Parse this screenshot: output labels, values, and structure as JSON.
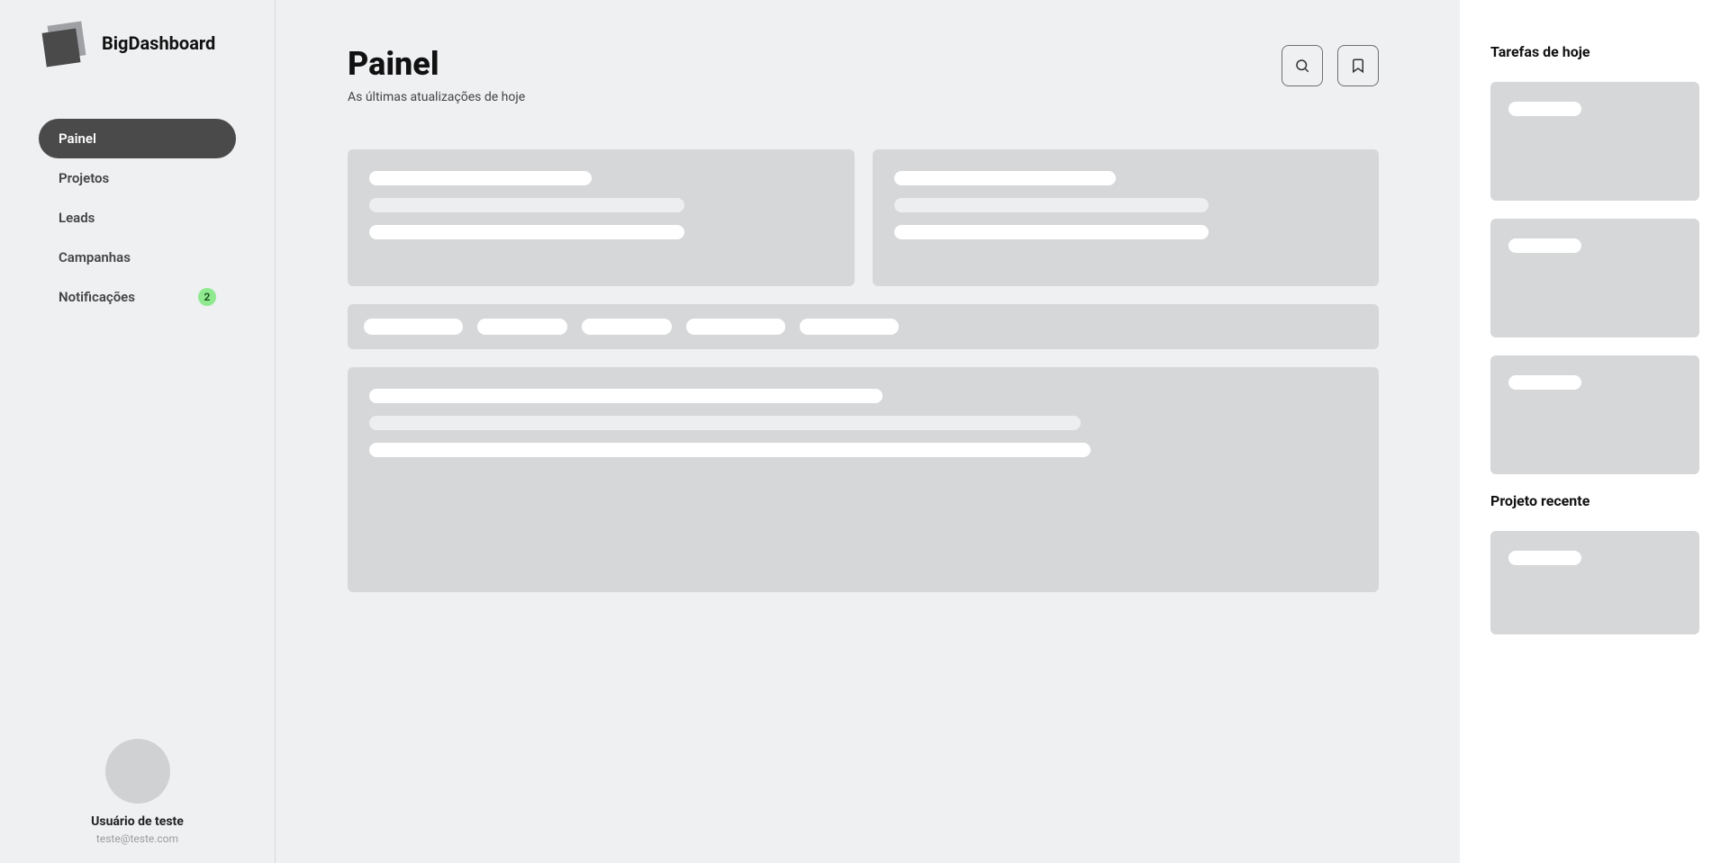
{
  "brand": {
    "title": "BigDashboard"
  },
  "nav": {
    "items": [
      {
        "label": "Painel",
        "active": true
      },
      {
        "label": "Projetos",
        "active": false
      },
      {
        "label": "Leads",
        "active": false
      },
      {
        "label": "Campanhas",
        "active": false
      },
      {
        "label": "Notificações",
        "active": false,
        "badge": "2"
      }
    ]
  },
  "user": {
    "name": "Usuário de teste",
    "email": "teste@teste.com"
  },
  "main": {
    "title": "Painel",
    "subtitle": "As últimas atualizações de hoje"
  },
  "right": {
    "tasks_heading": "Tarefas de hoje",
    "project_heading": "Projeto recente"
  }
}
